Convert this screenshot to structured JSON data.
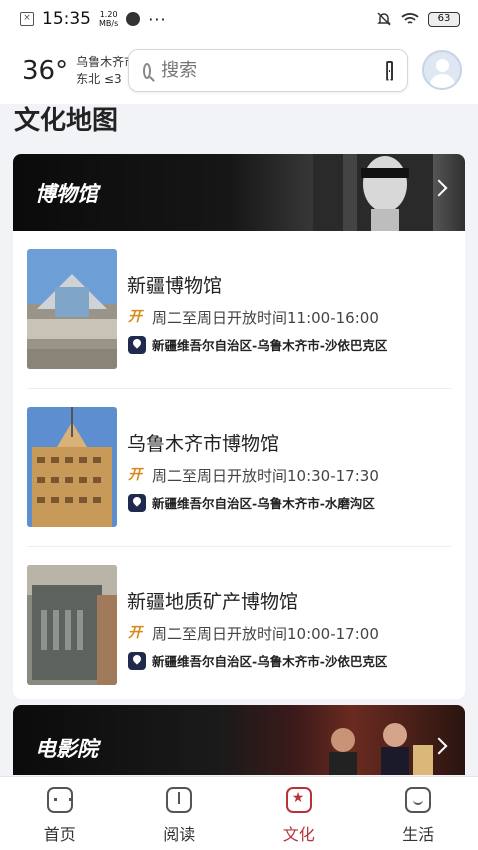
{
  "status_bar": {
    "time": "15:35",
    "speed_value": "1.20",
    "speed_unit": "MB/s",
    "battery": "63"
  },
  "header": {
    "temperature": "36°",
    "city": "乌鲁木齐市",
    "wind": "东北  ≤3",
    "search_placeholder": "搜索"
  },
  "page_title": "文化地图",
  "sections": [
    {
      "title": "博物馆",
      "items": [
        {
          "name": "新疆博物馆",
          "hours": "周二至周日开放时间11:00-16:00",
          "address": "新疆维吾尔自治区-乌鲁木齐市-沙依巴克区"
        },
        {
          "name": "乌鲁木齐市博物馆",
          "hours": "周二至周日开放时间10:30-17:30",
          "address": "新疆维吾尔自治区-乌鲁木齐市-水磨沟区"
        },
        {
          "name": "新疆地质矿产博物馆",
          "hours": "周二至周日开放时间10:00-17:00",
          "address": "新疆维吾尔自治区-乌鲁木齐市-沙依巴克区"
        }
      ]
    },
    {
      "title": "电影院"
    }
  ],
  "open_badge": "开",
  "tabs": [
    {
      "label": "首页",
      "icon": "home-icon"
    },
    {
      "label": "阅读",
      "icon": "book-icon"
    },
    {
      "label": "文化",
      "icon": "culture-icon",
      "active": true
    },
    {
      "label": "生活",
      "icon": "life-icon"
    }
  ],
  "colors": {
    "accent": "#b8323a",
    "pin": "#1f2a4c",
    "open_badge": "#d78a1a"
  }
}
